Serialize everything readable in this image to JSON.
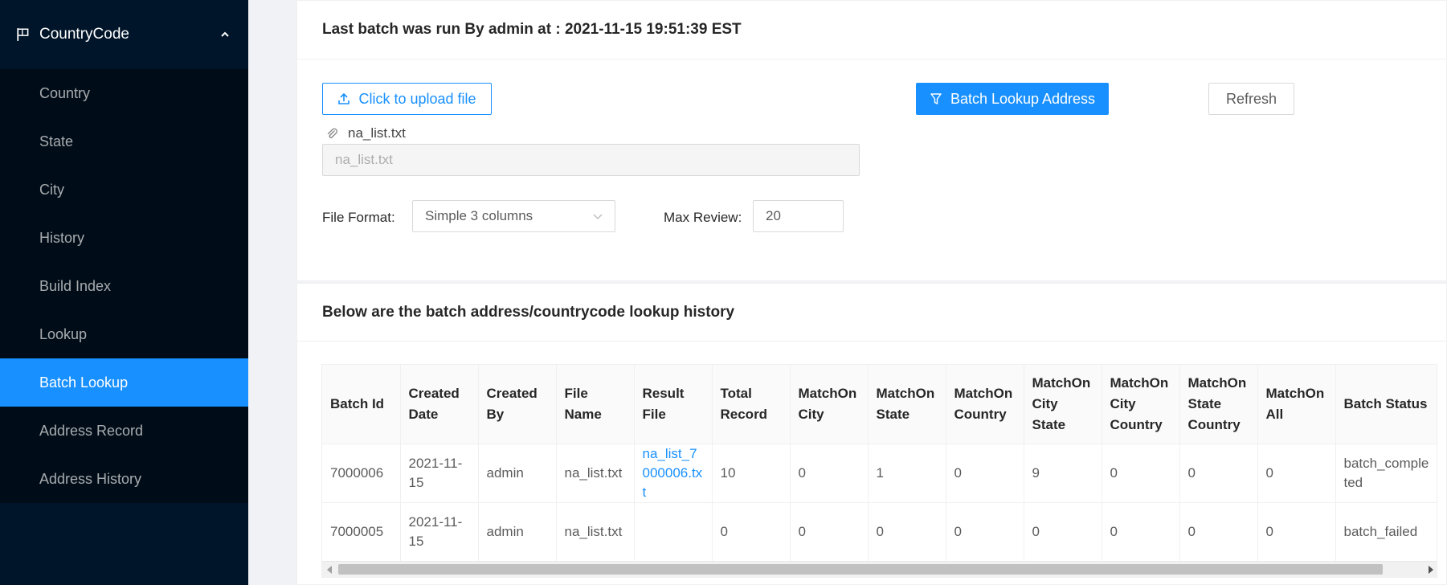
{
  "sidebar": {
    "menu_title": "CountryCode",
    "items": [
      {
        "label": "Country",
        "active": false
      },
      {
        "label": "State",
        "active": false
      },
      {
        "label": "City",
        "active": false
      },
      {
        "label": "History",
        "active": false
      },
      {
        "label": "Build Index",
        "active": false
      },
      {
        "label": "Lookup",
        "active": false
      },
      {
        "label": "Batch Lookup",
        "active": true
      },
      {
        "label": "Address Record",
        "active": false
      },
      {
        "label": "Address History",
        "active": false
      }
    ]
  },
  "batch_panel": {
    "title": "Last batch was run By admin at : 2021-11-15 19:51:39 EST",
    "upload_label": "Click to upload file",
    "batch_lookup_label": "Batch Lookup Address",
    "refresh_label": "Refresh",
    "attached_file": "na_list.txt",
    "file_input_value": "na_list.txt",
    "file_format_label": "File Format:",
    "file_format_value": "Simple 3 columns",
    "max_review_label": "Max Review:",
    "max_review_value": "20"
  },
  "history_panel": {
    "title": "Below are the batch address/countrycode lookup history",
    "columns": [
      "Batch Id",
      "Created Date",
      "Created By",
      "File Name",
      "Result File",
      "Total Record",
      "MatchOn City",
      "MatchOn State",
      "MatchOn Country",
      "MatchOn City State",
      "MatchOn City Country",
      "MatchOn State Country",
      "MatchOn All",
      "Batch Status"
    ],
    "rows": [
      [
        "7000006",
        "2021-11-15",
        "admin",
        "na_list.txt",
        "na_list_7000006.txt",
        "10",
        "0",
        "1",
        "0",
        "9",
        "0",
        "0",
        "0",
        "batch_completed"
      ],
      [
        "7000005",
        "2021-11-15",
        "admin",
        "na_list.txt",
        "",
        "0",
        "0",
        "0",
        "0",
        "0",
        "0",
        "0",
        "0",
        "batch_failed"
      ]
    ]
  },
  "colors": {
    "sidebar_bg": "#001529",
    "submenu_bg": "#000c17",
    "primary": "#1890ff"
  }
}
